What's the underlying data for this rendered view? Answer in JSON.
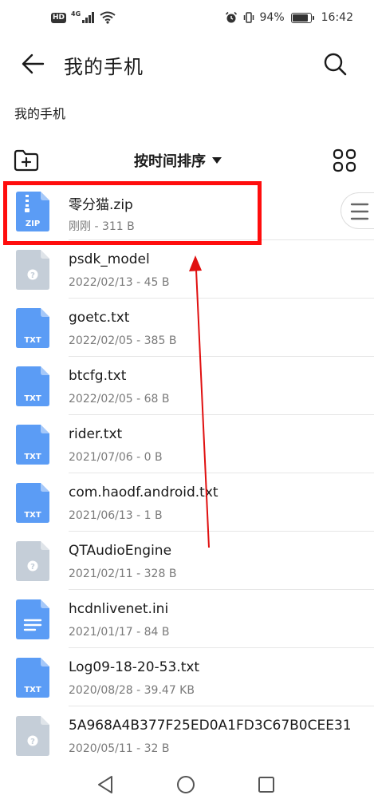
{
  "status_bar": {
    "hd": "HD",
    "network": "4G",
    "battery": "94%",
    "battery_level": 0.94,
    "time": "16:42"
  },
  "header": {
    "title": "我的手机"
  },
  "breadcrumb": "我的手机",
  "toolbar": {
    "sort_label": "按时间排序"
  },
  "files": [
    {
      "name": "零分猫.zip",
      "meta": "刚刚 - 311 B",
      "type": "zip",
      "icon_label": "ZIP",
      "icon_color": "#5b9cf5"
    },
    {
      "name": "psdk_model",
      "meta": "2022/02/13 - 45 B",
      "type": "unknown",
      "icon_label": "",
      "icon_color": "#c5ced8"
    },
    {
      "name": "goetc.txt",
      "meta": "2022/02/05 - 385 B",
      "type": "txt",
      "icon_label": "TXT",
      "icon_color": "#5b9cf5"
    },
    {
      "name": "btcfg.txt",
      "meta": "2022/02/05 - 68 B",
      "type": "txt",
      "icon_label": "TXT",
      "icon_color": "#5b9cf5"
    },
    {
      "name": "rider.txt",
      "meta": "2021/07/06 - 0 B",
      "type": "txt",
      "icon_label": "TXT",
      "icon_color": "#5b9cf5"
    },
    {
      "name": "com.haodf.android.txt",
      "meta": "2021/06/13 - 1 B",
      "type": "txt",
      "icon_label": "TXT",
      "icon_color": "#5b9cf5"
    },
    {
      "name": "QTAudioEngine",
      "meta": "2021/02/11 - 328 B",
      "type": "unknown",
      "icon_label": "",
      "icon_color": "#c5ced8"
    },
    {
      "name": "hcdnlivenet.ini",
      "meta": "2021/01/17 - 84 B",
      "type": "doc",
      "icon_label": "",
      "icon_color": "#5b9cf5"
    },
    {
      "name": "Log09-18-20-53.txt",
      "meta": "2020/08/28 - 39.47 KB",
      "type": "txt",
      "icon_label": "TXT",
      "icon_color": "#5b9cf5"
    },
    {
      "name": "5A968A4B377F25ED0A1FD3C67B0CEE31",
      "meta": "2020/05/11 - 32 B",
      "type": "unknown",
      "icon_label": "",
      "icon_color": "#c5ced8"
    }
  ],
  "colors": {
    "accent_blue": "#5b9cf5",
    "unknown_gray": "#c5ced8",
    "highlight_red": "#ff0d0d",
    "arrow_red": "#e01010"
  }
}
